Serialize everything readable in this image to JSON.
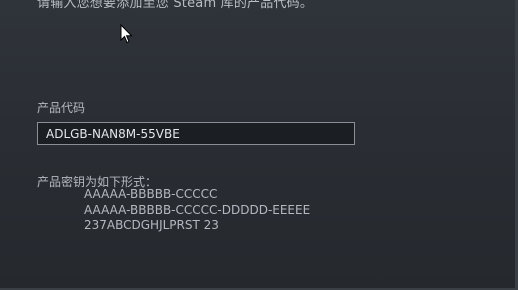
{
  "dialog": {
    "instruction": "请输入您想要添加至您 Steam 库的产品代码。"
  },
  "product_code": {
    "label": "产品代码",
    "value": "ADLGB-NAN8M-55VBE"
  },
  "formats": {
    "label": "产品密钥为如下形式：",
    "examples": [
      "AAAAA-BBBBB-CCCCC",
      "AAAAA-BBBBB-CCCCC-DDDDD-EEEEE",
      "237ABCDGHJLPRST 23"
    ]
  },
  "icons": {
    "cursor": "mouse-pointer-icon"
  },
  "colors": {
    "background": "#2b2f35",
    "field_background": "#1b1e22",
    "field_border": "#8a8f96",
    "text": "#b4b9c1"
  }
}
